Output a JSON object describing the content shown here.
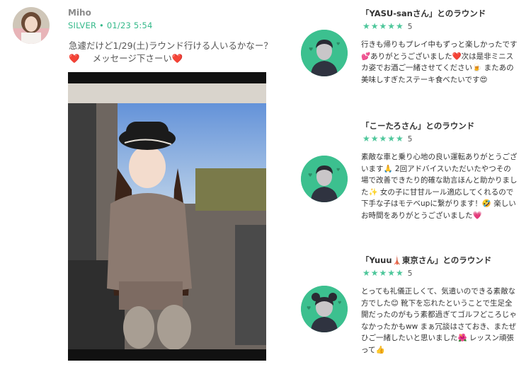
{
  "post": {
    "username": "Miho",
    "rank": "SILVER",
    "separator": "•",
    "timestamp": "01/23 5:54",
    "text_line1": "急遽だけど1/29(土)ラウンド行ける人いるかなー？",
    "text_line2": "メッセージ下さーい",
    "heart": "❤️"
  },
  "reviews": [
    {
      "title": "「YASU-sanさん」とのラウンド",
      "stars": "★★★★★",
      "score": "5",
      "body": "行きも帰りもプレイ中もずっと楽しかったです💕ありがとうございました❤️次は是非ミニスカ姿でお酒ご一緒させてください🍺 またあの美味しすぎたステーキ食べたいです😍"
    },
    {
      "title": "「こーたろさん」とのラウンド",
      "stars": "★★★★★",
      "score": "5",
      "body": "素敵な車と乗り心地の良い運転ありがとうございます🙏 2回アドバイスいただいたやつその場で改善できたり的確な助言ほんと助かりました✨ 女の子に甘甘ルール適応してくれるので下手な子はモテベupに繋がります！🤣 楽しいお時間をありがとうございました💗"
    },
    {
      "title": "「Yuuu🗼東京さん」とのラウンド",
      "stars": "★★★★★",
      "score": "5",
      "body": "とっても礼儀正しくて、気遣いのできる素敵な方でした😊 靴下を忘れたということで生足全開だったのがもう素都過ぎてゴルフどころじゃなかったかもww まぁ冗談はさておき、またぜひご一緒したいと思いました🌺 レッスン頑張って👍"
    }
  ],
  "colors": {
    "accent": "#35b98a",
    "avatar_green": "#3cc08f",
    "star": "#4ec79b",
    "heart": "#d8203a"
  }
}
